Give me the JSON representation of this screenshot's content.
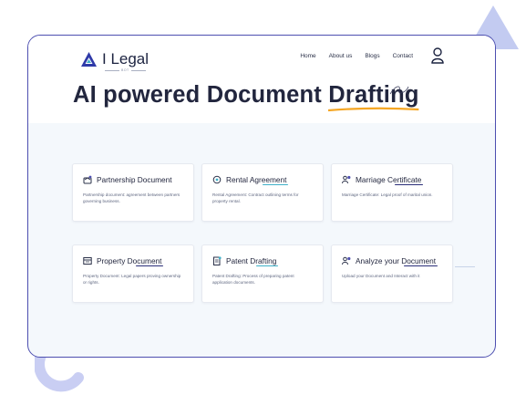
{
  "brand": {
    "name": "I Legal",
    "tagline": "BOT"
  },
  "nav": [
    "Home",
    "About us",
    "Blogs",
    "Contact"
  ],
  "hero": {
    "prefix": "AI powered Document ",
    "highlight": "Drafting"
  },
  "cards": [
    {
      "title": "Partnership Document",
      "icon": "handshake-icon",
      "desc": "Partnership document: agreement between partners governing business."
    },
    {
      "title": "Rental Agreement",
      "icon": "home-key-icon",
      "desc": "Rental Agreement: Contract outlining terms for property rental."
    },
    {
      "title": "Marriage Certificate",
      "icon": "couple-icon",
      "desc": "Marriage Certificate: Legal proof of marital union."
    },
    {
      "title": "Property Document",
      "icon": "property-doc-icon",
      "desc": "Property Document: Legal papers proving ownership or rights."
    },
    {
      "title": "Patent Drafting",
      "icon": "patent-doc-icon",
      "desc": "Patent Drafting: Process of preparing patent application documents."
    },
    {
      "title": "Analyze your Document",
      "icon": "analyze-user-icon",
      "desc": "Upload your Document and Interact with it"
    }
  ],
  "colors": {
    "accent": "#4d4fb0",
    "highlight_underline": "#f5a623",
    "background": "#f4f8fc"
  }
}
